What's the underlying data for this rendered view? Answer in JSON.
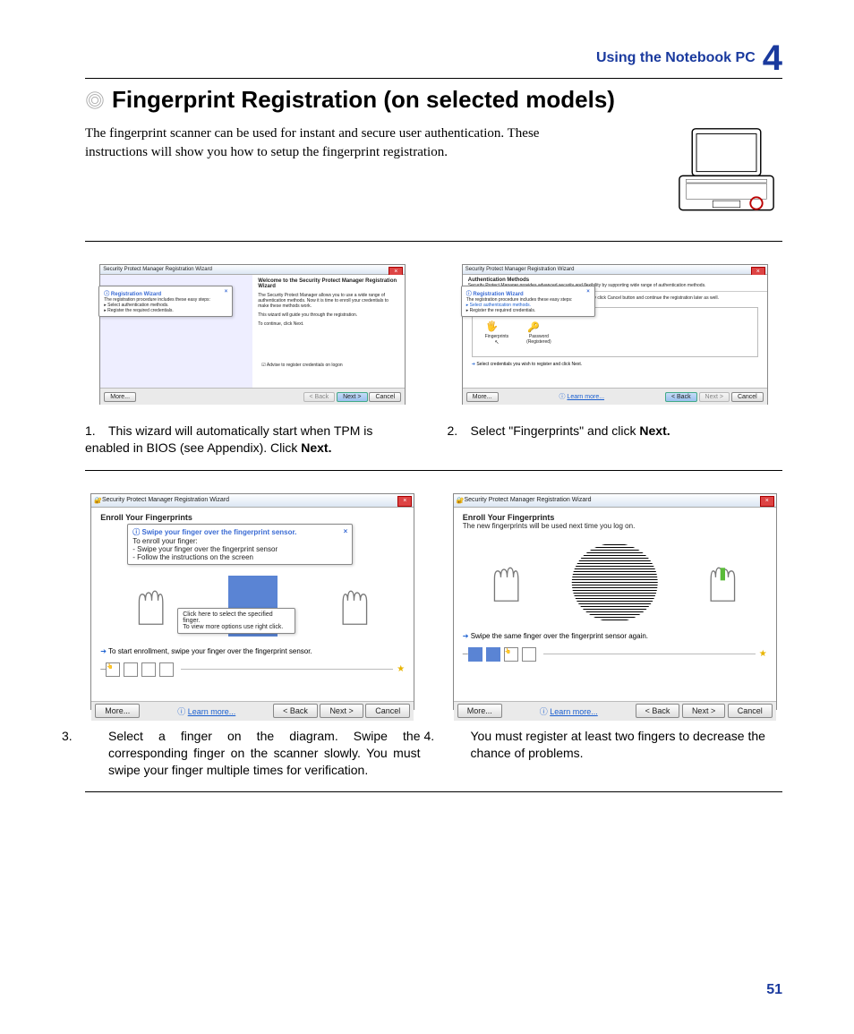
{
  "header": {
    "section": "Using the Notebook PC",
    "chapter": "4"
  },
  "title": "Fingerprint Registration (on selected models)",
  "intro": "The fingerprint scanner can be used for instant and secure user authentication. These instructions will show you how to setup the fingerprint registration.",
  "steps": {
    "s1": {
      "num": "1.",
      "text_a": "This wizard will automatically start when TPM is enabled in BIOS (see  Appendix). Click ",
      "text_b": "Next."
    },
    "s2": {
      "num": "2.",
      "text_a": "Select \"Fingerprints\" and click ",
      "text_b": "Next."
    },
    "s3": {
      "num": "3.",
      "text": "Select a finger on the diagram. Swipe the corresponding finger on the scanner slowly. You must swipe your finger multiple times for verification."
    },
    "s4": {
      "num": "4.",
      "text": "You must register at least two fingers to decrease the chance of problems."
    }
  },
  "wiz_common": {
    "title": "Security Protect Manager Registration Wizard",
    "tooltip_title": "Registration Wizard",
    "tooltip_body": "The registration procedure includes these easy steps:",
    "tooltip_b1": "Select authentication methods.",
    "tooltip_b2": "Register the required credentials.",
    "more": "More...",
    "learn": "Learn more...",
    "back": "< Back",
    "next": "Next >",
    "cancel": "Cancel"
  },
  "wiz1": {
    "heading": "Welcome to the Security Protect Manager Registration Wizard",
    "body1": "The Security Protect Manager allows you to use a wide range of authentication methods. Now it is time to enroll your credentials to make these methods work.",
    "body2": "This wizard will guide you through the registration.",
    "body3": "To continue, click Next.",
    "checkbox": "Advise to register credentials on logon"
  },
  "wiz2": {
    "heading": "Authentication Methods",
    "sub": "Security Protect Manager provides advanced security and flexibility by supporting wide range of authentication methods.",
    "body": "Please register credentials for authentication methods. You may click Cancel button and continue the registration later as well.",
    "opt1": "Fingerprints",
    "opt2": "Password",
    "opt2sub": "(Registered)",
    "hint": "Select credentials you wish to register and click Next."
  },
  "wiz3": {
    "heading": "Enroll Your Fingerprints",
    "tip_title": "Swipe your finger over the fingerprint sensor.",
    "tip_body": "To enroll your finger:",
    "tip_b1": "- Swipe your finger over the fingerprint sensor",
    "tip_b2": "- Follow the instructions on the screen",
    "finger_tip": "Click here to select the specified finger.",
    "finger_tip2": "To view more options use right click.",
    "hint": "To start enrollment, swipe your finger over the fingerprint sensor."
  },
  "wiz4": {
    "heading": "Enroll Your Fingerprints",
    "sub": "The new fingerprints will be used next time you log on.",
    "hint": "Swipe the same finger over the fingerprint sensor again."
  },
  "page_num": "51"
}
